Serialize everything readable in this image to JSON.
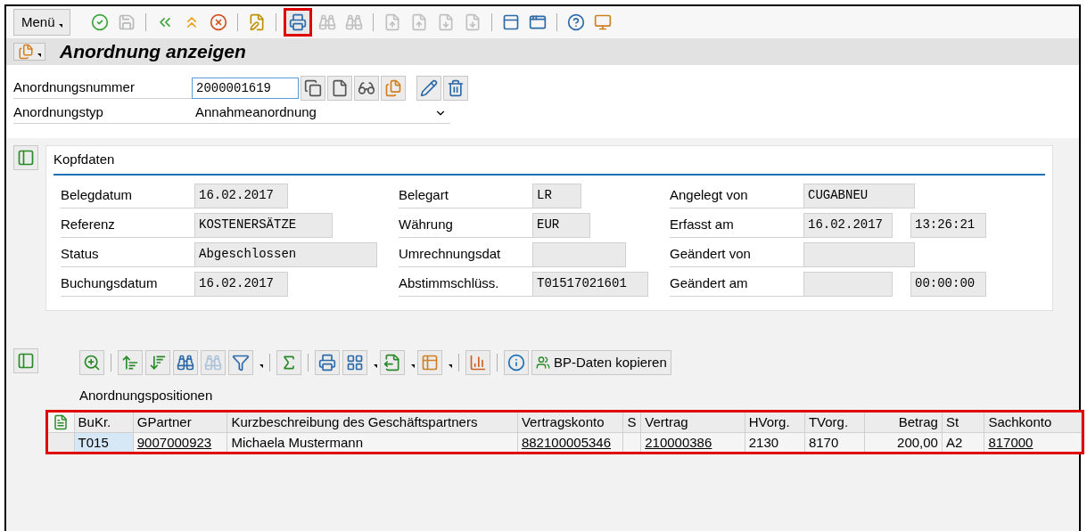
{
  "toolbar": {
    "menu_label": "Menü",
    "print_highlighted": true
  },
  "title": "Anordnung anzeigen",
  "fields": [
    {
      "label": "Anordnungsnummer",
      "value": "2000001619",
      "kind": "input"
    },
    {
      "label": "Anordnungstyp",
      "value": "Annahmeanordnung",
      "kind": "select"
    }
  ],
  "header_section": {
    "title": "Kopfdaten",
    "columns": [
      [
        {
          "label": "Belegdatum",
          "value": "16.02.2017"
        },
        {
          "label": "Referenz",
          "value": "KOSTENERSÄTZE"
        },
        {
          "label": "Status",
          "value": "Abgeschlossen"
        },
        {
          "label": "Buchungsdatum",
          "value": "16.02.2017"
        }
      ],
      [
        {
          "label": "Belegart",
          "value": "LR"
        },
        {
          "label": "Währung",
          "value": "EUR"
        },
        {
          "label": "Umrechnungsdat"
        },
        {
          "label": "Abstimmschlüss.",
          "value": "T01517021601"
        }
      ],
      [
        {
          "label": "Angelegt von",
          "value": "CUGABNEU"
        },
        {
          "label": "Erfasst am",
          "value": "16.02.2017",
          "extra": "13:26:21"
        },
        {
          "label": "Geändert von"
        },
        {
          "label": "Geändert am",
          "extra": "00:00:00"
        }
      ]
    ]
  },
  "positions": {
    "copy_button": "BP-Daten kopieren",
    "title": "Anordnungspositionen",
    "highlighted": true,
    "columns": [
      {
        "label": "BuKr.",
        "kind": "key"
      },
      {
        "label": "GPartner",
        "kind": "link"
      },
      {
        "label": "Kurzbeschreibung des Geschäftspartners",
        "kind": "text"
      },
      {
        "label": "Vertragskonto",
        "kind": "link"
      },
      {
        "label": "S",
        "kind": "text"
      },
      {
        "label": "Vertrag",
        "kind": "link"
      },
      {
        "label": "HVorg.",
        "kind": "text"
      },
      {
        "label": "TVorg.",
        "kind": "text"
      },
      {
        "label": "Betrag",
        "kind": "amount"
      },
      {
        "label": "St",
        "kind": "text"
      },
      {
        "label": "Sachkonto",
        "kind": "link"
      }
    ],
    "rows": [
      [
        "T015",
        "9007000923",
        "Michaela Mustermann",
        "882100005346",
        null,
        "210000386",
        "2130",
        "8170",
        "200,00",
        "A2",
        "817000"
      ]
    ]
  }
}
